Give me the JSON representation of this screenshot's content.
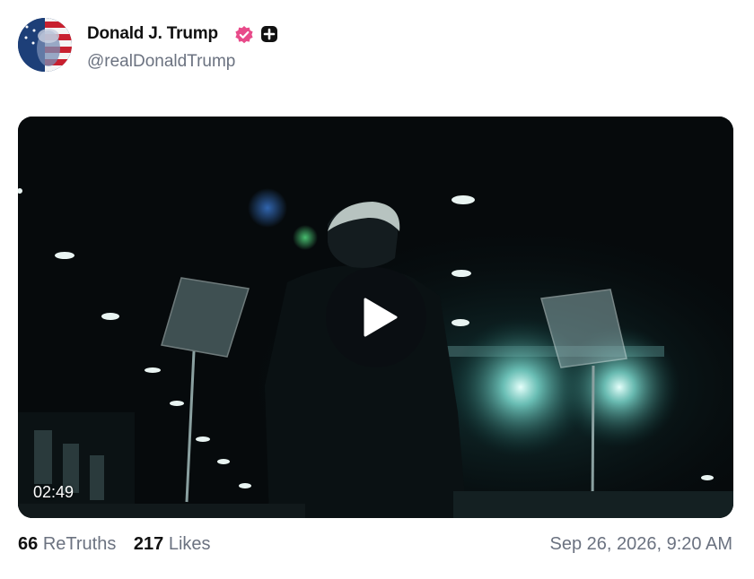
{
  "post": {
    "author": {
      "display_name": "Donald J. Trump",
      "handle": "@realDonaldTrump",
      "verified_icon": "verified-badge-icon",
      "plus_icon": "plus-badge-icon",
      "verified_color": "#e84b8a"
    },
    "media": {
      "type": "video",
      "duration": "02:49",
      "play_icon": "play-icon"
    },
    "stats": {
      "retruths_count": "66",
      "retruths_label": "ReTruths",
      "likes_count": "217",
      "likes_label": "Likes"
    },
    "timestamp": "Sep 26, 2026, 9:20 AM"
  }
}
